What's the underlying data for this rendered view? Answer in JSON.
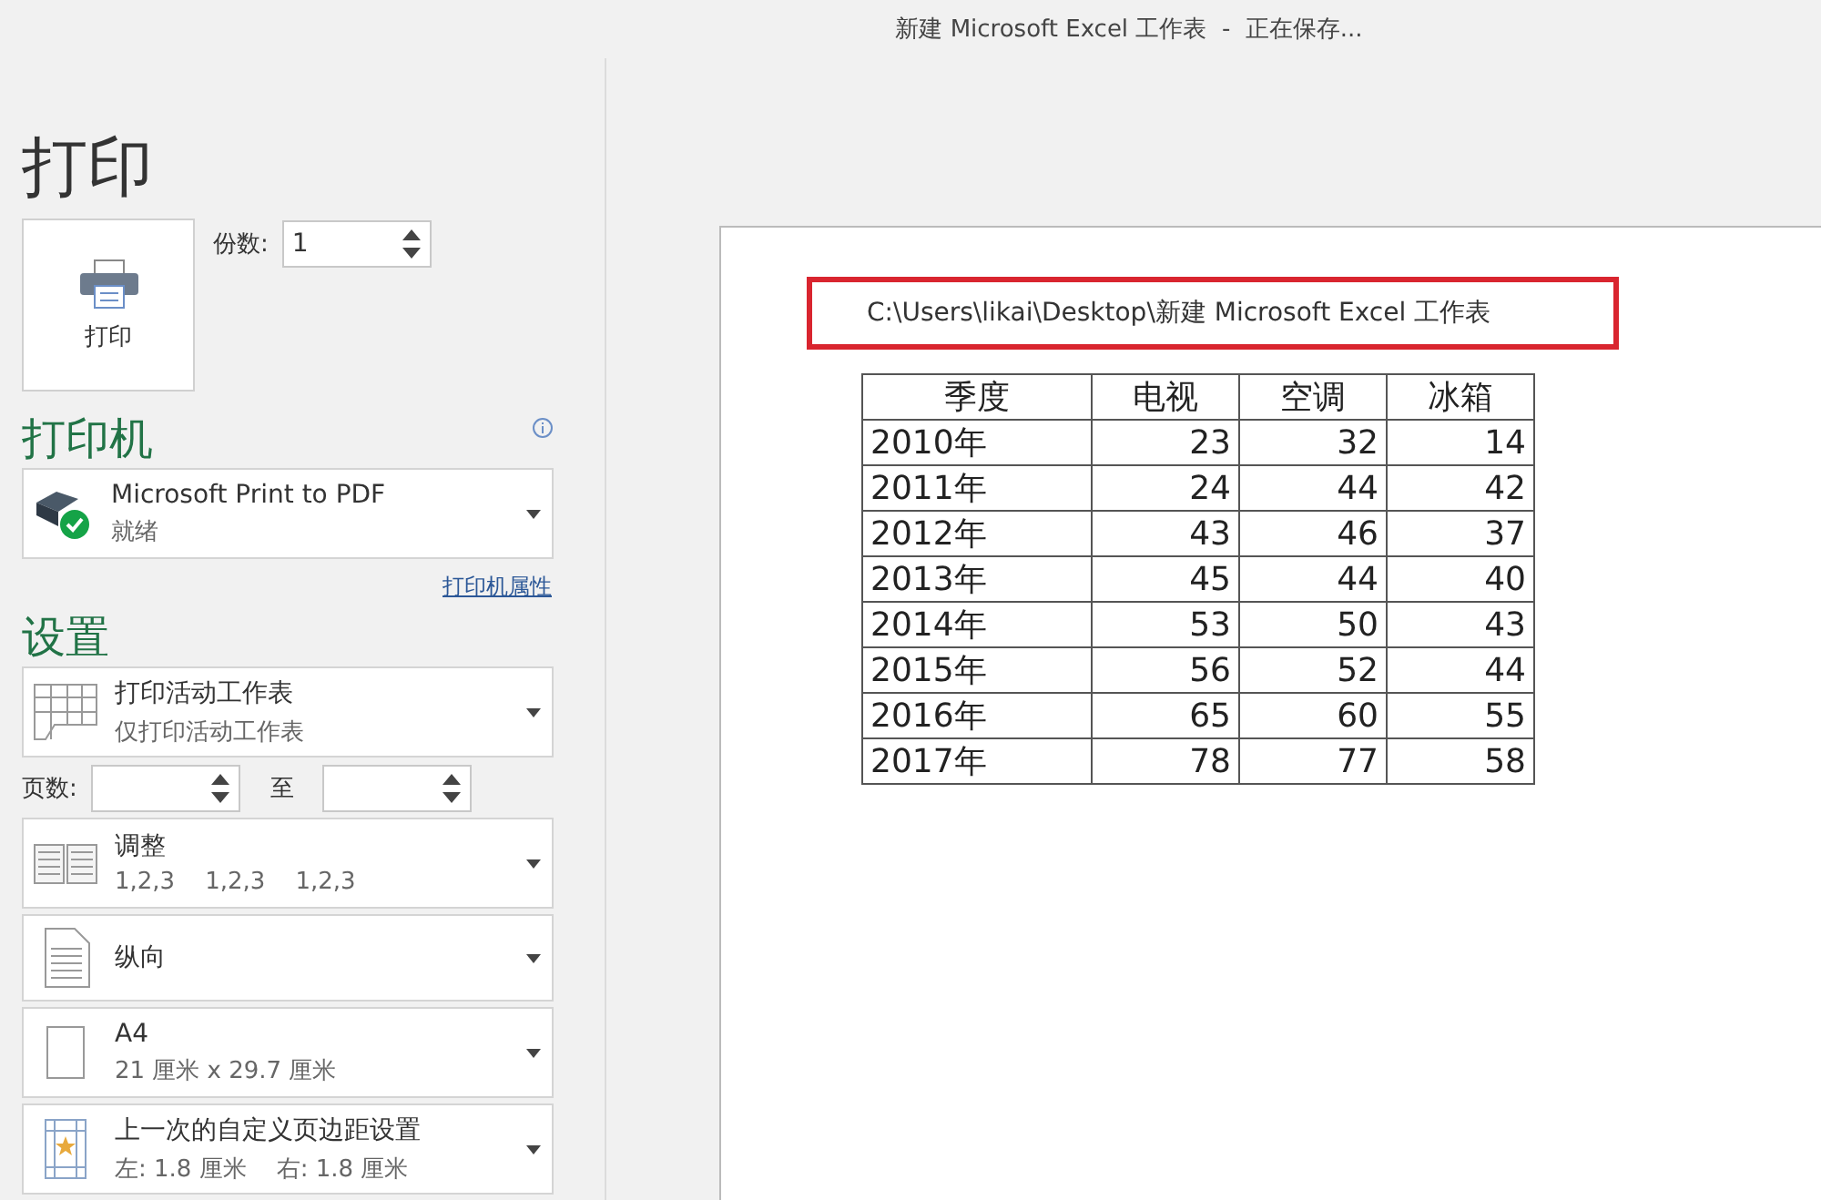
{
  "window": {
    "title": "新建 Microsoft Excel 工作表  -  正在保存..."
  },
  "page_title": "打印",
  "print_button": {
    "label": "打印"
  },
  "copies": {
    "label": "份数:",
    "value": "1"
  },
  "printer": {
    "heading": "打印机",
    "name": "Microsoft Print to PDF",
    "status": "就绪",
    "properties_link": "打印机属性"
  },
  "settings": {
    "heading": "设置",
    "items": [
      {
        "kind": "sheets",
        "title": "打印活动工作表",
        "subtitle": "仅打印活动工作表"
      },
      {
        "kind": "pages",
        "label": "页数:",
        "to_label": "至"
      },
      {
        "kind": "collate",
        "title": "调整",
        "subtitle": "1,2,3    1,2,3    1,2,3"
      },
      {
        "kind": "portrait",
        "title": "纵向"
      },
      {
        "kind": "paper",
        "title": "A4",
        "subtitle": "21 厘米 x 29.7 厘米"
      },
      {
        "kind": "margins",
        "title": "上一次的自定义页边距设置",
        "subtitle": "左: 1.8 厘米    右: 1.8 厘米"
      }
    ]
  },
  "preview": {
    "header": "C:\\Users\\likai\\Desktop\\新建 Microsoft Excel 工作表",
    "header_highlighted": true,
    "columns": [
      "季度",
      "电视",
      "空调",
      "冰箱"
    ],
    "rows": [
      [
        "2010年",
        "23",
        "32",
        "14"
      ],
      [
        "2011年",
        "24",
        "44",
        "42"
      ],
      [
        "2012年",
        "43",
        "46",
        "37"
      ],
      [
        "2013年",
        "45",
        "44",
        "40"
      ],
      [
        "2014年",
        "53",
        "50",
        "43"
      ],
      [
        "2015年",
        "56",
        "52",
        "44"
      ],
      [
        "2016年",
        "65",
        "60",
        "55"
      ],
      [
        "2017年",
        "78",
        "77",
        "58"
      ]
    ]
  }
}
